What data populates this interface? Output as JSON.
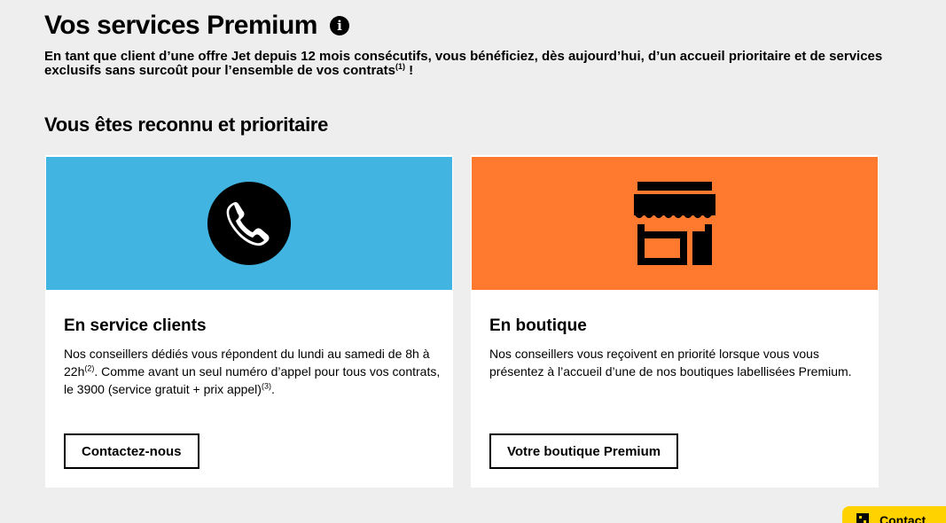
{
  "header": {
    "title": "Vos services Premium",
    "info_icon": "info-icon",
    "intro_text": "En tant que client d’une offre Jet depuis 12 mois consécutifs, vous bénéficiez, dès aujourd’hui, d’un accueil prioritaire et de services exclusifs sans surcoût pour l’ensemble de vos contrats",
    "intro_note": "(1)",
    "intro_end": " !"
  },
  "section": {
    "title": "Vous êtes reconnu et prioritaire"
  },
  "cards": [
    {
      "icon": "phone-icon",
      "banner_color": "#41b4e2",
      "title": "En service clients",
      "text_part1": "Nos conseillers dédiés vous répondent du lundi au samedi de 8h à 22h",
      "note1": "(2)",
      "text_part2": ". Comme avant un seul numéro d’appel pour tous vos contrats, le 3900 (service gratuit + prix appel)",
      "note2": "(3)",
      "text_part3": ".",
      "button_label": "Contactez-nous"
    },
    {
      "icon": "shop-icon",
      "banner_color": "#ff7a2e",
      "title": "En boutique",
      "text": "Nos conseillers vous reçoivent en priorité lorsque vous vous présentez à l’accueil d’une de nos boutiques labellisées Premium.",
      "button_label": "Votre boutique Premium"
    }
  ],
  "contact_tab": {
    "icon": "chat-icon",
    "label": "Contact",
    "color": "#ffd200"
  }
}
